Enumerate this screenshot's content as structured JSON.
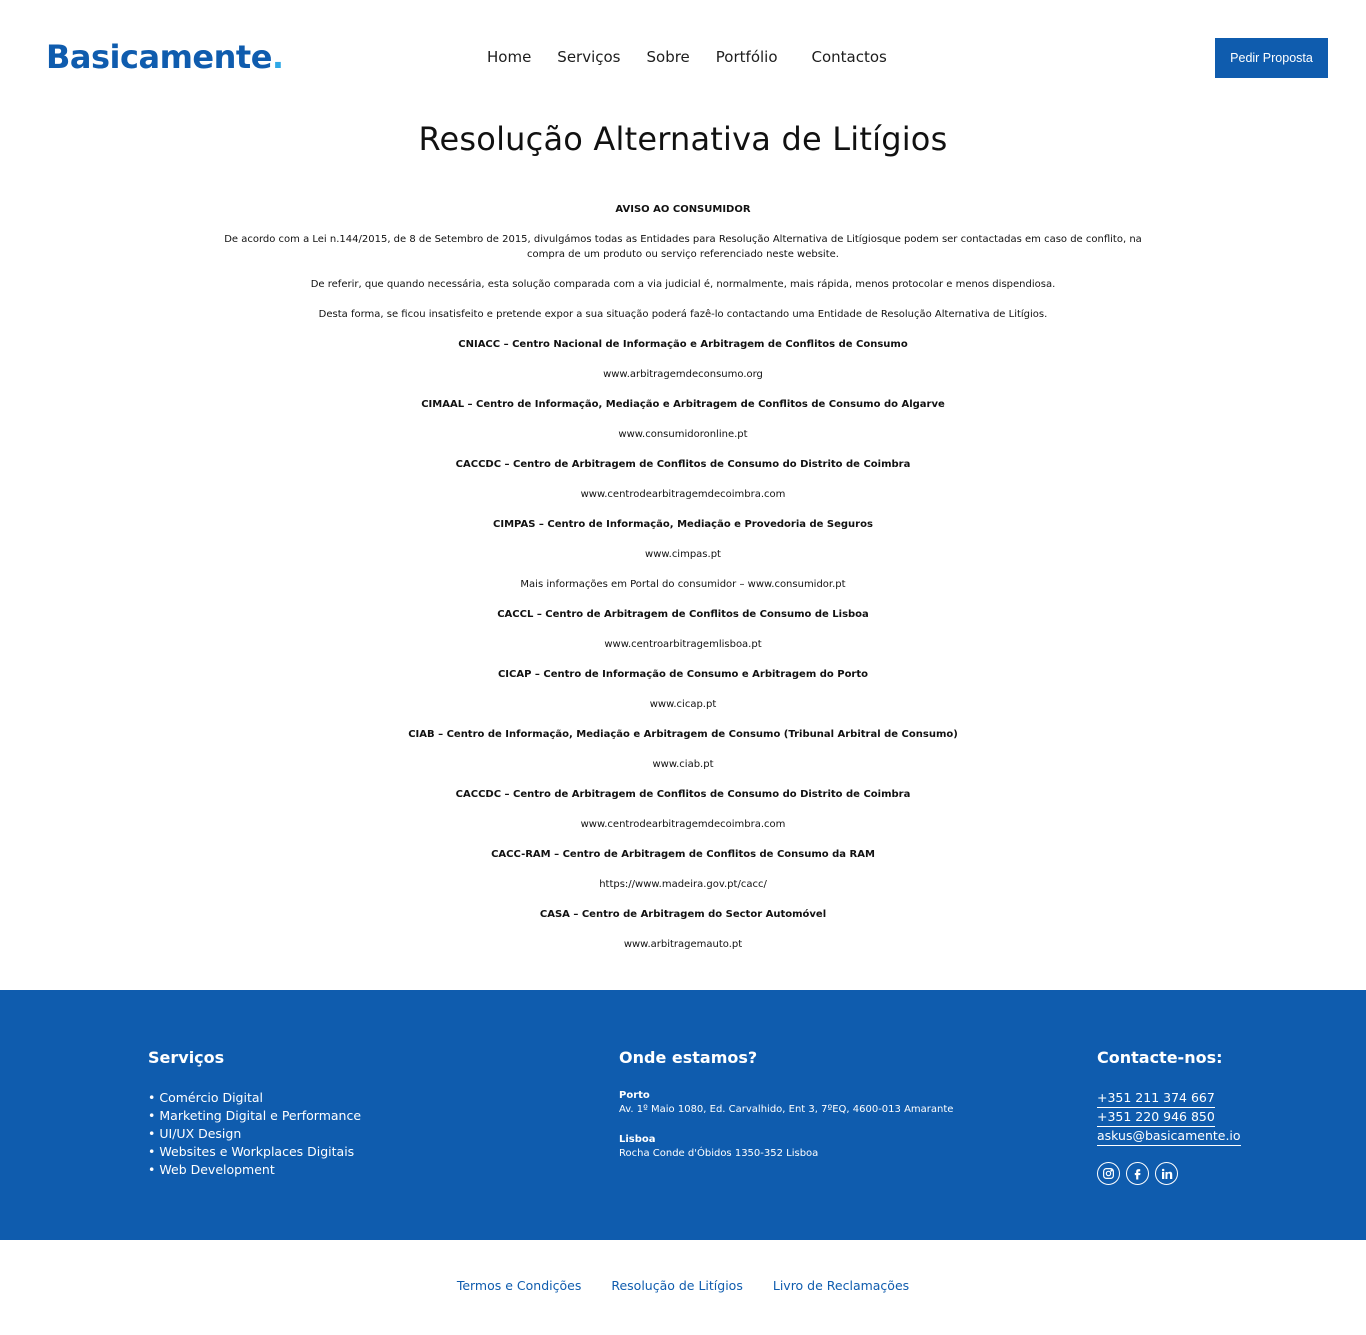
{
  "header": {
    "logo_text": "Basicamente",
    "logo_dot": ".",
    "nav": [
      "Home",
      "Serviços",
      "Sobre",
      "Portfólio",
      "Contactos"
    ],
    "cta_label": "Pedir Proposta"
  },
  "page": {
    "title": "Resolução Alternativa de Litígios",
    "notice_heading": "AVISO AO CONSUMIDOR",
    "paragraphs": [
      "De acordo com a Lei n.144/2015, de 8 de Setembro de 2015, divulgámos todas as Entidades para Resolução Alternativa de Litígiosque podem ser contactadas em caso de conflito, na compra de um produto ou serviço referenciado neste website.",
      "De referir, que quando necessária, esta solução comparada com a via judicial é, normalmente, mais rápida, menos protocolar e menos dispendiosa.",
      "Desta forma, se ficou insatisfeito e pretende expor a sua situação poderá fazê-lo contactando uma Entidade de Resolução Alternativa de Litígios."
    ],
    "entities": [
      {
        "name": "CNIACC – Centro Nacional de Informação e Arbitragem de Conflitos de Consumo",
        "url": "www.arbitragemdeconsumo.org"
      },
      {
        "name": "CIMAAL – Centro de Informação, Mediação e Arbitragem de Conflitos de Consumo do Algarve",
        "url": "www.consumidoronline.pt"
      },
      {
        "name": "CACCDC – Centro de Arbitragem de Conflitos de Consumo do Distrito de Coimbra",
        "url": "www.centrodearbitragemdecoimbra.com"
      },
      {
        "name": "CIMPAS – Centro de Informação, Mediação e Provedoria de Seguros",
        "url": "www.cimpas.pt"
      }
    ],
    "more_info": "Mais informações em Portal do consumidor – www.consumidor.pt",
    "entities2": [
      {
        "name": "CACCL – Centro de Arbitragem de Conflitos de Consumo de Lisboa",
        "url": "www.centroarbitragemlisboa.pt"
      },
      {
        "name": "CICAP – Centro de Informação de Consumo e Arbitragem do Porto",
        "url": "www.cicap.pt"
      },
      {
        "name": "CIAB – Centro de Informação, Mediação e Arbitragem de Consumo (Tribunal Arbitral de Consumo)",
        "url": "www.ciab.pt"
      },
      {
        "name": "CACCDC – Centro de Arbitragem de Conflitos de Consumo do Distrito de Coimbra",
        "url": "www.centrodearbitragemdecoimbra.com"
      },
      {
        "name": "CACC-RAM – Centro de Arbitragem de Conflitos de Consumo da RAM",
        "url": "https://www.madeira.gov.pt/cacc/"
      },
      {
        "name": "CASA – Centro de Arbitragem do Sector Automóvel",
        "url": "www.arbitragemauto.pt"
      }
    ]
  },
  "footer": {
    "services_title": "Serviços",
    "services": [
      "Comércio Digital",
      "Marketing Digital e Performance",
      "UI/UX Design",
      "Websites e Workplaces Digitais",
      "Web Development"
    ],
    "location_title": "Onde estamos?",
    "locations": [
      {
        "city": "Porto",
        "address": "Av. 1º Maio 1080, Ed. Carvalhido, Ent 3, 7ºEQ, 4600-013 Amarante"
      },
      {
        "city": "Lisboa",
        "address": "Rocha Conde d'Óbidos 1350-352 Lisboa"
      }
    ],
    "contact_title": "Contacte-nos:",
    "phone1": "+351 211 374 667",
    "phone2": "+351 220 946 850",
    "email": "askus@basicamente.io",
    "socials": [
      "instagram-icon",
      "facebook-icon",
      "linkedin-icon"
    ]
  },
  "bottom_links": [
    "Termos e Condições",
    "Resolução de Litígios",
    "Livro de Reclamações"
  ],
  "colors": {
    "brand": "#0f5cae",
    "accent": "#2ea8e6"
  }
}
